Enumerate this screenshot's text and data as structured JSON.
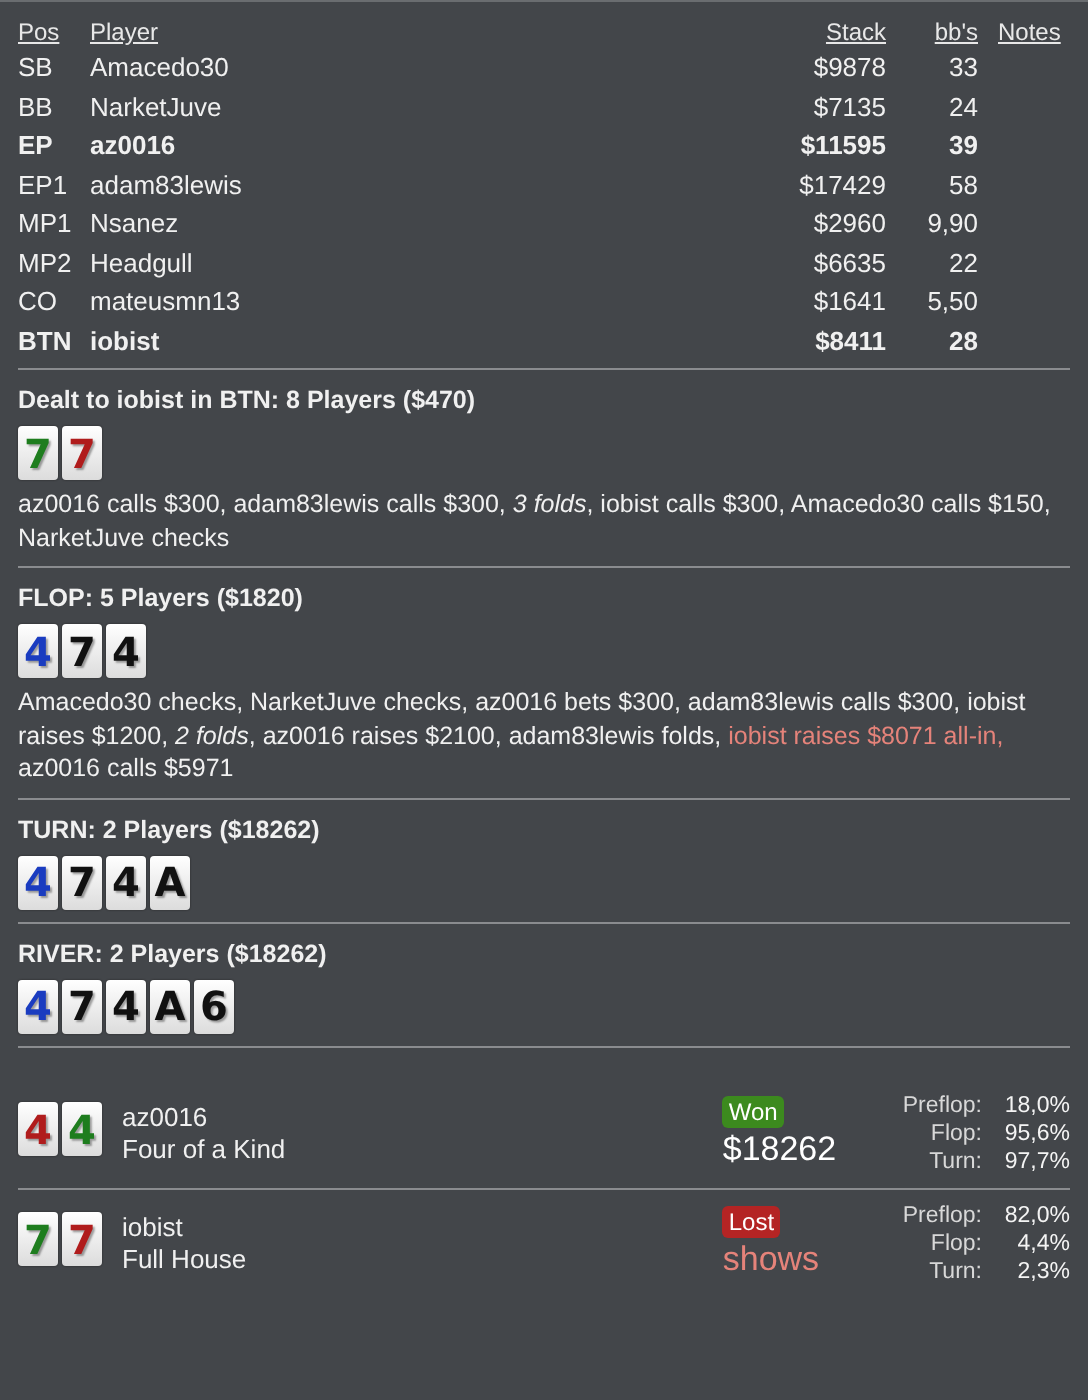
{
  "table": {
    "columns": [
      "Pos",
      "Player",
      "Stack",
      "bb's",
      "Notes"
    ],
    "rows": [
      {
        "pos": "SB",
        "player": "Amacedo30",
        "stack": "$9878",
        "bbs": "33",
        "bold": false
      },
      {
        "pos": "BB",
        "player": "NarketJuve",
        "stack": "$7135",
        "bbs": "24",
        "bold": false
      },
      {
        "pos": "EP",
        "player": "az0016",
        "stack": "$11595",
        "bbs": "39",
        "bold": true
      },
      {
        "pos": "EP1",
        "player": "adam83lewis",
        "stack": "$17429",
        "bbs": "58",
        "bold": false
      },
      {
        "pos": "MP1",
        "player": "Nsanez",
        "stack": "$2960",
        "bbs": "9,90",
        "bold": false
      },
      {
        "pos": "MP2",
        "player": "Headgull",
        "stack": "$6635",
        "bbs": "22",
        "bold": false
      },
      {
        "pos": "CO",
        "player": "mateusmn13",
        "stack": "$1641",
        "bbs": "5,50",
        "bold": false
      },
      {
        "pos": "BTN",
        "player": "iobist",
        "stack": "$8411",
        "bbs": "28",
        "bold": true
      }
    ]
  },
  "streets": [
    {
      "title": "Dealt to iobist in BTN: 8 Players ($470)",
      "cards": [
        {
          "rank": "7",
          "color": "#1e7d1e"
        },
        {
          "rank": "7",
          "color": "#b01c1c"
        }
      ],
      "actions": [
        {
          "kind": "plain",
          "text": "az0016 calls $300, adam83lewis calls $300, "
        },
        {
          "kind": "italic",
          "text": "3 folds"
        },
        {
          "kind": "plain",
          "text": ", iobist calls $300, Amacedo30 calls $150, NarketJuve checks"
        }
      ]
    },
    {
      "title": "FLOP: 5 Players ($1820)",
      "cards": [
        {
          "rank": "4",
          "color": "#1a3cc0"
        },
        {
          "rank": "7",
          "color": "#111111"
        },
        {
          "rank": "4",
          "color": "#111111"
        }
      ],
      "actions": [
        {
          "kind": "plain",
          "text": "Amacedo30 checks, NarketJuve checks, az0016 bets $300, adam83lewis calls $300, iobist raises $1200, "
        },
        {
          "kind": "italic",
          "text": "2 folds"
        },
        {
          "kind": "plain",
          "text": ", az0016 raises $2100, adam83lewis folds, "
        },
        {
          "kind": "highlight",
          "text": "iobist raises $8071 all-in,"
        },
        {
          "kind": "plain",
          "text": " az0016 calls $5971"
        }
      ]
    },
    {
      "title": "TURN: 2 Players ($18262)",
      "cards": [
        {
          "rank": "4",
          "color": "#1a3cc0"
        },
        {
          "rank": "7",
          "color": "#111111"
        },
        {
          "rank": "4",
          "color": "#111111"
        },
        {
          "rank": "A",
          "color": "#111111"
        }
      ]
    },
    {
      "title": "RIVER: 2 Players ($18262)",
      "cards": [
        {
          "rank": "4",
          "color": "#1a3cc0"
        },
        {
          "rank": "7",
          "color": "#111111"
        },
        {
          "rank": "4",
          "color": "#111111"
        },
        {
          "rank": "A",
          "color": "#111111"
        },
        {
          "rank": "6",
          "color": "#111111"
        }
      ]
    }
  ],
  "showdown": [
    {
      "cards": [
        {
          "rank": "4",
          "color": "#b01c1c"
        },
        {
          "rank": "4",
          "color": "#1e7d1e"
        }
      ],
      "player": "az0016",
      "hand": "Four of a Kind",
      "result": "Won",
      "won": true,
      "amount": "$18262",
      "equity": [
        {
          "label": "Preflop:",
          "value": "18,0%"
        },
        {
          "label": "Flop:",
          "value": "95,6%"
        },
        {
          "label": "Turn:",
          "value": "97,7%"
        }
      ]
    },
    {
      "cards": [
        {
          "rank": "7",
          "color": "#1e7d1e"
        },
        {
          "rank": "7",
          "color": "#b01c1c"
        }
      ],
      "player": "iobist",
      "hand": "Full House",
      "result": "Lost",
      "won": false,
      "amount": "shows",
      "equity": [
        {
          "label": "Preflop:",
          "value": "82,0%"
        },
        {
          "label": "Flop:",
          "value": "4,4%"
        },
        {
          "label": "Turn:",
          "value": "2,3%"
        }
      ]
    }
  ]
}
